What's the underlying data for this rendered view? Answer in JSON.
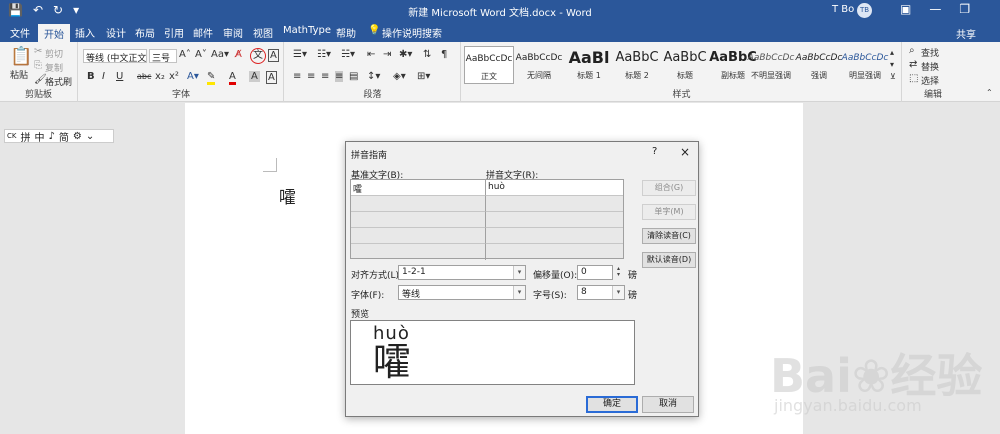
{
  "app": {
    "title": "新建 Microsoft Word 文档.docx - Word",
    "user_name": "T Bo",
    "user_initials": "TB",
    "share_label": "共享",
    "accent": "#2b579a"
  },
  "tabs": [
    {
      "label": "文件",
      "active": false
    },
    {
      "label": "开始",
      "active": true
    },
    {
      "label": "插入",
      "active": false
    },
    {
      "label": "设计",
      "active": false
    },
    {
      "label": "布局",
      "active": false
    },
    {
      "label": "引用",
      "active": false
    },
    {
      "label": "邮件",
      "active": false
    },
    {
      "label": "审阅",
      "active": false
    },
    {
      "label": "视图",
      "active": false
    },
    {
      "label": "MathType",
      "active": false
    },
    {
      "label": "帮助",
      "active": false
    }
  ],
  "tell_me": "操作说明搜索",
  "ribbon": {
    "clipboard": {
      "label": "剪贴板",
      "paste": "粘贴",
      "cut": "剪切",
      "copy": "复制",
      "format_painter": "格式刷"
    },
    "font": {
      "label": "字体",
      "font_name": "等线 (中文正文",
      "font_size": "三号",
      "buttons": [
        "B",
        "I",
        "U",
        "abc",
        "x₂",
        "x²"
      ]
    },
    "paragraph": {
      "label": "段落"
    },
    "styles": {
      "label": "样式",
      "items": [
        {
          "sample": "AaBbCcDc",
          "name": "正文",
          "active": true
        },
        {
          "sample": "AaBbCcDc",
          "name": "无间隔",
          "active": false
        },
        {
          "sample": "AaBl",
          "name": "标题 1",
          "active": false
        },
        {
          "sample": "AaBbC",
          "name": "标题 2",
          "active": false
        },
        {
          "sample": "AaBbC",
          "name": "标题",
          "active": false
        },
        {
          "sample": "AaBbC",
          "name": "副标题",
          "active": false
        },
        {
          "sample": "AaBbCcDc",
          "name": "不明显强调",
          "active": false
        },
        {
          "sample": "AaBbCcDc",
          "name": "强调",
          "active": false
        },
        {
          "sample": "AaBbCcDc",
          "name": "明显强调",
          "active": false
        }
      ]
    },
    "editing": {
      "label": "编辑",
      "find": "查找",
      "replace": "替换",
      "select": "选择"
    }
  },
  "floatbar": {
    "items": [
      "CK",
      "拼",
      "中",
      "♪",
      "简",
      "⚙",
      "⌄"
    ]
  },
  "document": {
    "char": "嚯"
  },
  "dialog": {
    "title": "拼音指南",
    "help": "?",
    "close": "×",
    "base_label": "基准文字(B):",
    "ruby_label": "拼音文字(R):",
    "base_text": "嚯",
    "ruby_text": "huò",
    "buttons": {
      "group": "组合(G)",
      "single": "单字(M)",
      "clear": "清除读音(C)",
      "default": "默认读音(D)"
    },
    "align_label": "对齐方式(L):",
    "align_value": "1-2-1",
    "offset_label": "偏移量(O):",
    "offset_value": "0",
    "offset_unit": "磅",
    "font_label": "字体(F):",
    "font_value": "等线",
    "size_label": "字号(S):",
    "size_value": "8",
    "size_unit": "磅",
    "preview_label": "预览",
    "preview_ruby": "huò",
    "preview_base": "嚯",
    "ok": "确定",
    "cancel": "取消"
  },
  "watermark": {
    "line1": "Bai❀经验",
    "line2": "jingyan.baidu.com"
  }
}
